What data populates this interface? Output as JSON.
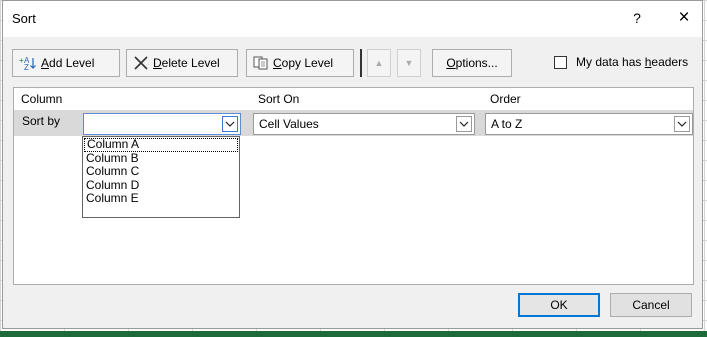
{
  "dialog": {
    "title": "Sort",
    "help_label": "?",
    "close_label": "×"
  },
  "toolbar": {
    "add_level": {
      "prefix": "",
      "accel": "A",
      "rest": "dd Level"
    },
    "delete_level": {
      "accel": "D",
      "rest": "elete Level"
    },
    "copy_level": {
      "accel": "C",
      "rest": "opy Level"
    },
    "move_up_label": "▲",
    "move_down_label": "▼",
    "options": {
      "accel": "O",
      "rest": "ptions..."
    },
    "headers_label_prefix": "My data has ",
    "headers_accel": "h",
    "headers_rest": "eaders",
    "headers_checked": false
  },
  "grid": {
    "col_header_column": "Column",
    "col_header_sort_on": "Sort On",
    "col_header_order": "Order",
    "row_label": "Sort by",
    "column_value": "",
    "sort_on_value": "Cell Values",
    "order_value": "A to Z"
  },
  "column_dropdown": {
    "options": [
      "Column A",
      "Column B",
      "Column C",
      "Column D",
      "Column E"
    ],
    "focused_index": 0
  },
  "buttons": {
    "ok": "OK",
    "cancel": "Cancel"
  },
  "colors": {
    "accent": "#0078d7",
    "excel_green": "#1e6b3a"
  }
}
